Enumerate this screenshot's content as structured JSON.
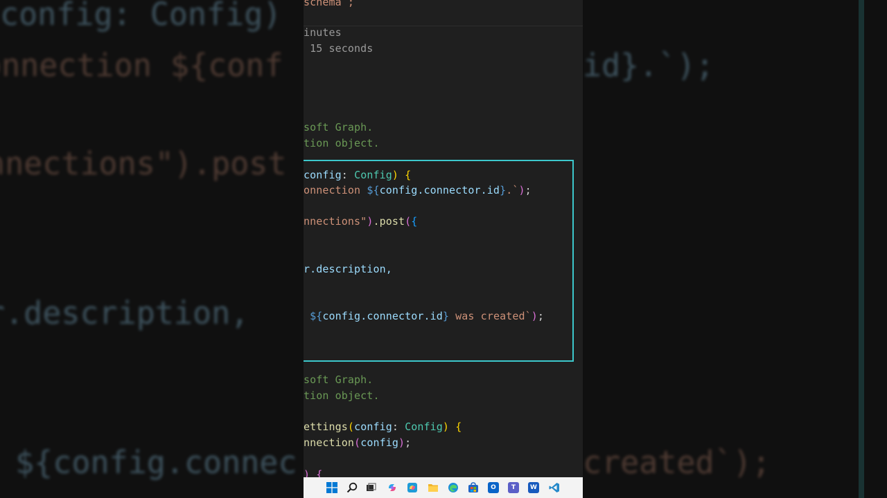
{
  "background": {
    "left_lines": [
      {
        "text": "config: Config)",
        "color": "#9cdcfe"
      },
      {
        "text": "onnection ${conf",
        "color": "#ce9178"
      },
      {
        "text": "nnections\").post",
        "color": "#ce9178"
      },
      {
        "text": "r.description,",
        "color": "#9cdcfe"
      },
      {
        "text": " ${config.connec",
        "color": "#9cdcfe"
      }
    ],
    "right_lines": [
      {
        "text": "id}.`);",
        "color": "#9cdcfe"
      },
      {
        "text": "created`);",
        "color": "#ce9178"
      }
    ]
  },
  "editor": {
    "top_fragment": "schema`;",
    "duration_line_1": "inutes",
    "duration_line_2": " 15 seconds",
    "comment_1a": "soft Graph.",
    "comment_1b": "tion object.",
    "code": {
      "l1_var": "config",
      "l1_colon": ": ",
      "l1_type": "Config",
      "l1_close": ")",
      "l1_brace": " {",
      "l2_str": "onnection ",
      "l2_tpl": "${",
      "l2_var": "config.connector.id",
      "l2_tpl_end": "}",
      "l2_str_end": ".`",
      "l2_close": ")",
      "l2_semi": ";",
      "l3_str": "nnections\"",
      "l3_close": ")",
      "l3_method": ".post",
      "l3_open": "(",
      "l3_brace": "{",
      "l4_text": "r.description,",
      "l5_tpl": " ${",
      "l5_var": "config.connector.id",
      "l5_tpl_end": "}",
      "l5_str": " was created`",
      "l5_close": ")",
      "l5_semi": ";"
    },
    "comment_2a": "soft Graph.",
    "comment_2b": "tion object.",
    "code2": {
      "l1_fn": "ettings",
      "l1_open": "(",
      "l1_var": "config",
      "l1_colon": ": ",
      "l1_type": "Config",
      "l1_close": ")",
      "l1_brace": " {",
      "l2_fn": "nnection",
      "l2_open": "(",
      "l2_var": "config",
      "l2_close": ")",
      "l2_semi": ";",
      "l3_frag": ") {"
    }
  },
  "taskbar": {
    "icons": [
      "windows-start-icon",
      "search-icon",
      "task-view-icon",
      "copilot-icon",
      "copilot-app-icon",
      "file-explorer-icon",
      "edge-icon",
      "store-icon",
      "outlook-icon",
      "teams-icon",
      "word-icon",
      "vscode-icon"
    ],
    "outlook_letter": "O",
    "teams_letter": "T",
    "word_letter": "W"
  },
  "colors": {
    "highlight": "#3cc8cc",
    "editor_bg": "#1f1f1f",
    "taskbar_bg": "#f3f3f3"
  }
}
